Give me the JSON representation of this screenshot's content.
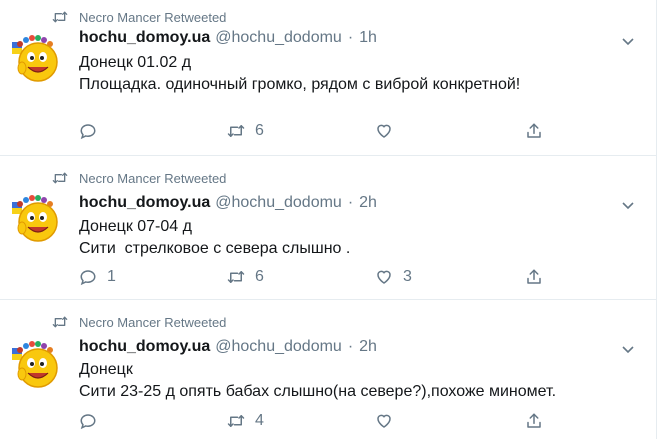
{
  "tweets": [
    {
      "retweeted_by": "Necro Mancer Retweeted",
      "name": "hochu_domoy.ua",
      "handle": "@hochu_dodomu",
      "separator": "·",
      "time": "1h",
      "lines": [
        "Донецк 01.02 д",
        "Площадка. одиночный громко, рядом с виброй конкретной!"
      ],
      "reply_count": "",
      "retweet_count": "6",
      "like_count": ""
    },
    {
      "retweeted_by": "Necro Mancer Retweeted",
      "name": "hochu_domoy.ua",
      "handle": "@hochu_dodomu",
      "separator": "·",
      "time": "2h",
      "lines": [
        "Донецк 07-04 д",
        "Сити  стрелковое с севера слышно ."
      ],
      "reply_count": "1",
      "retweet_count": "6",
      "like_count": "3"
    },
    {
      "retweeted_by": "Necro Mancer Retweeted",
      "name": "hochu_domoy.ua",
      "handle": "@hochu_dodomu",
      "separator": "·",
      "time": "2h",
      "lines": [
        "Донецк",
        "Сити 23-25 д опять бабах слышно(на севере?),похоже миномет."
      ],
      "reply_count": "",
      "retweet_count": "4",
      "like_count": ""
    }
  ],
  "colors": {
    "secondary_text": "#657786",
    "border": "#e6ecf0",
    "primary_text": "#14171a"
  },
  "icons": [
    "retweet-icon",
    "avatar-emoji",
    "chevron-down-icon",
    "reply-icon",
    "like-icon",
    "share-icon"
  ]
}
